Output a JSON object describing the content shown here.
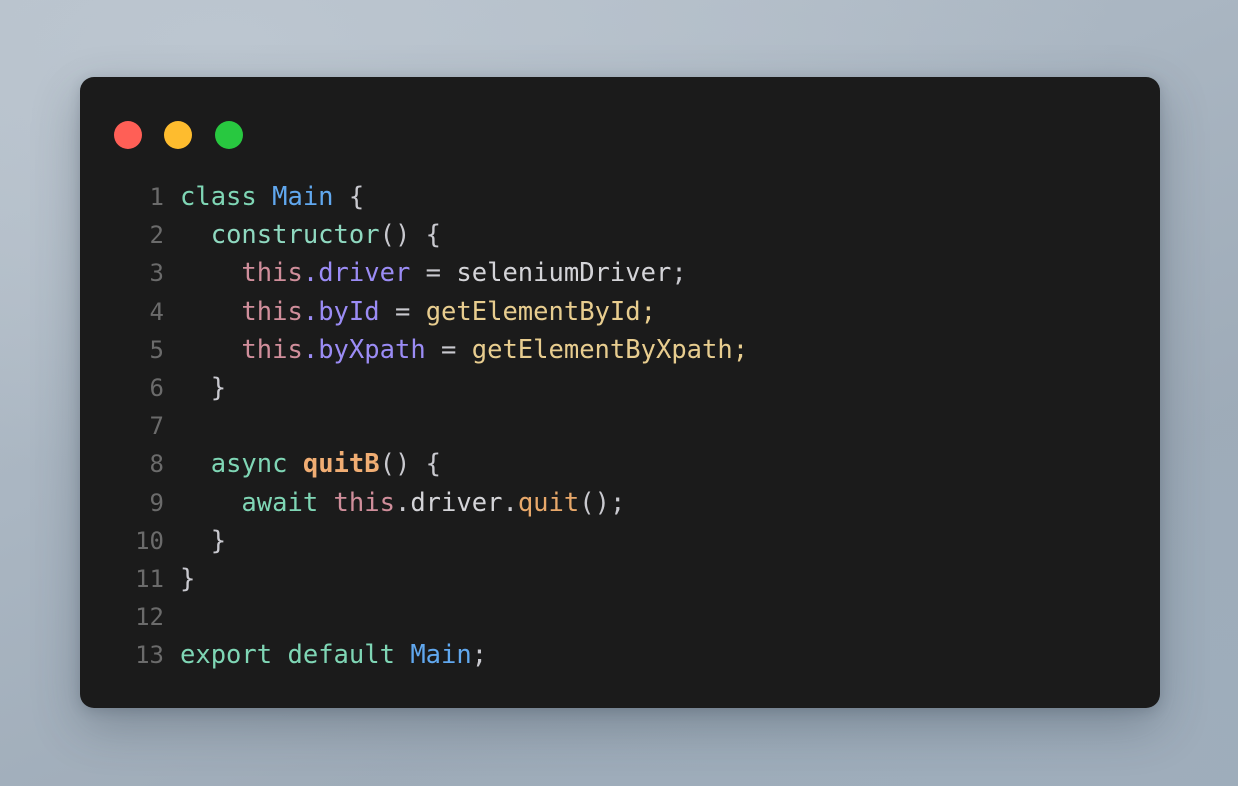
{
  "window": {
    "type": "code-snippet-card",
    "background_color": "#1b1b1b",
    "page_background_from": "#b6c0ca",
    "page_background_to": "#9badbb",
    "traffic_lights": [
      {
        "name": "close",
        "color": "#ff5f56"
      },
      {
        "name": "minimize",
        "color": "#febc2e"
      },
      {
        "name": "maximize",
        "color": "#28c840"
      }
    ]
  },
  "editor": {
    "language": "javascript",
    "total_lines": 13,
    "gutter_color": "#6b6b6b",
    "default_text_color": "#d4d4d8",
    "theme_colors": {
      "keyword": "#7fd6b5",
      "class_name": "#61a8ef",
      "method": "#8fd9c0",
      "this_keyword": "#d08e9b",
      "property": "#9b8cf5",
      "function": "#e8a86a",
      "string_value": "#e8cd8f",
      "punctuation": "#c9c9cf"
    },
    "line_numbers": [
      "1",
      "2",
      "3",
      "4",
      "5",
      "6",
      "7",
      "8",
      "9",
      "10",
      "11",
      "12",
      "13"
    ],
    "plain_code": "class Main {\n  constructor() {\n    this.driver = seleniumDriver;\n    this.byId = getElementById;\n    this.byXpath = getElementByXpath;\n  }\n\n  async quitB() {\n    await this.driver.quit();\n  }\n}\n\nexport default Main;",
    "lines": [
      {
        "number": "1",
        "tokens": [
          {
            "t": "class",
            "c": "tok-keyword"
          },
          {
            "t": " ",
            "c": "tok-punct"
          },
          {
            "t": "Main",
            "c": "tok-class"
          },
          {
            "t": " {",
            "c": "tok-punct"
          }
        ]
      },
      {
        "number": "2",
        "tokens": [
          {
            "t": "  ",
            "c": "tok-punct"
          },
          {
            "t": "constructor",
            "c": "tok-method"
          },
          {
            "t": "() {",
            "c": "tok-punct"
          }
        ]
      },
      {
        "number": "3",
        "tokens": [
          {
            "t": "    ",
            "c": "tok-punct"
          },
          {
            "t": "this",
            "c": "tok-this"
          },
          {
            "t": ".",
            "c": "tok-dot"
          },
          {
            "t": "driver",
            "c": "tok-prop"
          },
          {
            "t": " = ",
            "c": "tok-op"
          },
          {
            "t": "seleniumDriver",
            "c": "tok-ident"
          },
          {
            "t": ";",
            "c": "tok-punct"
          }
        ]
      },
      {
        "number": "4",
        "tokens": [
          {
            "t": "    ",
            "c": "tok-punct"
          },
          {
            "t": "this",
            "c": "tok-this"
          },
          {
            "t": ".",
            "c": "tok-dot"
          },
          {
            "t": "byId",
            "c": "tok-prop"
          },
          {
            "t": " = ",
            "c": "tok-op"
          },
          {
            "t": "getElementById",
            "c": "tok-value"
          },
          {
            "t": ";",
            "c": "tok-value"
          }
        ]
      },
      {
        "number": "5",
        "tokens": [
          {
            "t": "    ",
            "c": "tok-punct"
          },
          {
            "t": "this",
            "c": "tok-this"
          },
          {
            "t": ".",
            "c": "tok-dot"
          },
          {
            "t": "byXpath",
            "c": "tok-prop"
          },
          {
            "t": " = ",
            "c": "tok-op"
          },
          {
            "t": "getElementByXpath",
            "c": "tok-value"
          },
          {
            "t": ";",
            "c": "tok-value"
          }
        ]
      },
      {
        "number": "6",
        "tokens": [
          {
            "t": "  }",
            "c": "tok-punct"
          }
        ]
      },
      {
        "number": "7",
        "tokens": []
      },
      {
        "number": "8",
        "tokens": [
          {
            "t": "  ",
            "c": "tok-punct"
          },
          {
            "t": "async",
            "c": "tok-keyword"
          },
          {
            "t": " ",
            "c": "tok-punct"
          },
          {
            "t": "quitB",
            "c": "tok-funcbold"
          },
          {
            "t": "() {",
            "c": "tok-punct"
          }
        ]
      },
      {
        "number": "9",
        "tokens": [
          {
            "t": "    ",
            "c": "tok-punct"
          },
          {
            "t": "await",
            "c": "tok-keyword"
          },
          {
            "t": " ",
            "c": "tok-punct"
          },
          {
            "t": "this",
            "c": "tok-this"
          },
          {
            "t": ".",
            "c": "tok-punct"
          },
          {
            "t": "driver",
            "c": "tok-ident"
          },
          {
            "t": ".",
            "c": "tok-punct"
          },
          {
            "t": "quit",
            "c": "tok-func"
          },
          {
            "t": "();",
            "c": "tok-punct"
          }
        ]
      },
      {
        "number": "10",
        "tokens": [
          {
            "t": "  }",
            "c": "tok-punct"
          }
        ]
      },
      {
        "number": "11",
        "tokens": [
          {
            "t": "}",
            "c": "tok-punct"
          }
        ]
      },
      {
        "number": "12",
        "tokens": []
      },
      {
        "number": "13",
        "tokens": [
          {
            "t": "export",
            "c": "tok-keyword"
          },
          {
            "t": " ",
            "c": "tok-punct"
          },
          {
            "t": "default",
            "c": "tok-keyword"
          },
          {
            "t": " ",
            "c": "tok-punct"
          },
          {
            "t": "Main",
            "c": "tok-class"
          },
          {
            "t": ";",
            "c": "tok-punct"
          }
        ]
      }
    ]
  }
}
